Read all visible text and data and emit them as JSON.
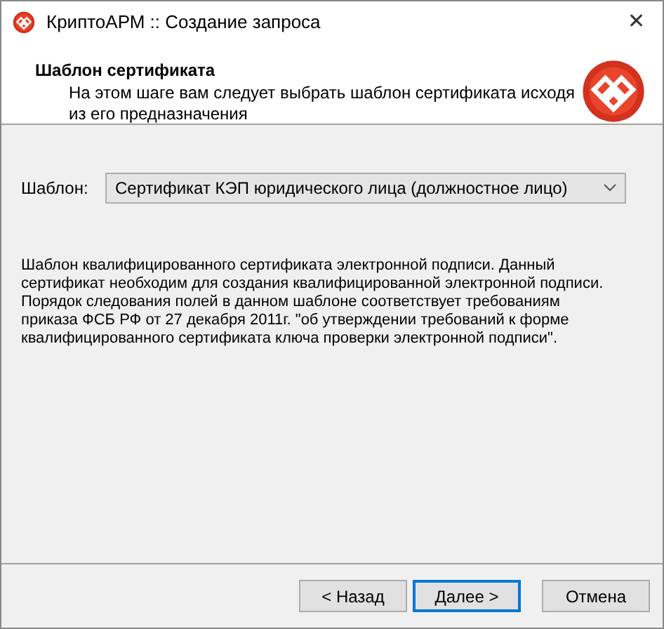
{
  "window": {
    "title": "КриптоАРМ :: Создание запроса",
    "close": "✕"
  },
  "header": {
    "title": "Шаблон сертификата",
    "subtitle": "На этом шаге вам следует выбрать шаблон сертификата исходя\nиз его предназначения"
  },
  "template_field": {
    "label": "Шаблон:",
    "value": "Сертификат КЭП юридического лица (должностное лицо)"
  },
  "description": "Шаблон квалифицированного сертификата электронной подписи. Данный\nсертификат необходим для создания квалифицированной электронной подписи.\nПорядок следования полей в данном шаблоне соответствует требованиям\nприказа ФСБ РФ от 27 декабря 2011г. \"об утверждении требований к форме\nквалифицированного сертификата ключа проверки электронной подписи\".",
  "buttons": [
    {
      "label": "< Назад",
      "focused": false
    },
    {
      "label": "Далее >",
      "focused": true
    },
    {
      "label": "Отмена",
      "focused": false
    }
  ]
}
